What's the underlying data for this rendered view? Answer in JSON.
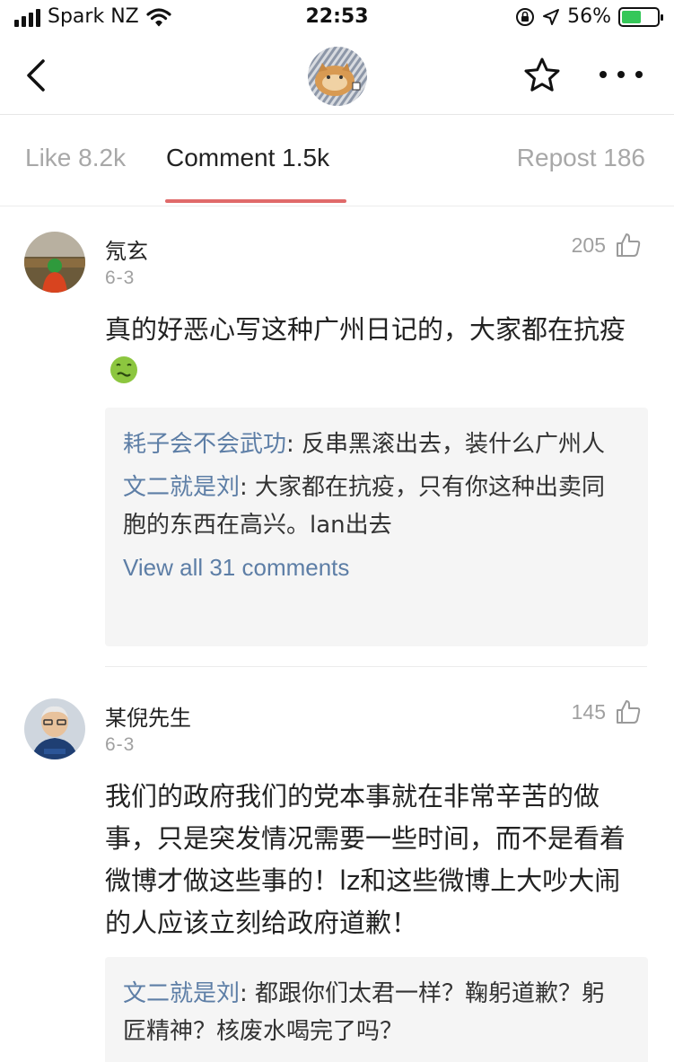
{
  "status_bar": {
    "carrier": "Spark NZ",
    "time": "22:53",
    "battery": "56%",
    "battery_level": 0.56,
    "icons": [
      "signal-icon",
      "wifi-icon",
      "orientation-lock-icon",
      "location-icon",
      "battery-charging-icon"
    ]
  },
  "nav": {
    "icons": [
      "back-chevron-icon",
      "star-icon",
      "more-dots-icon"
    ]
  },
  "tabs": [
    {
      "label": "Like 8.2k"
    },
    {
      "label": "Comment 1.5k"
    },
    {
      "label": "Repost 186"
    }
  ],
  "active_tab": "Comment 1.5k",
  "colors": {
    "accent": "#e06a6a",
    "link": "#5d7ea6",
    "reply_bg": "#f5f5f5"
  },
  "comments": [
    {
      "name": "氖玄",
      "date": "6-3",
      "likes": "205",
      "text": "真的好恶心写这种广州日记的，大家都在抗疫",
      "emoji": "nauseated-face-icon",
      "replies": [
        {
          "name": "耗子会不会武功",
          "sep": ": ",
          "text": "反串黑滚出去，装什么广州人"
        },
        {
          "name": "文二就是刘",
          "sep": ": ",
          "text": "大家都在抗疫，只有你这种出卖同胞的东西在高兴。lan出去"
        }
      ],
      "view_all": "View all 31 comments"
    },
    {
      "name": "某倪先生",
      "date": "6-3",
      "likes": "145",
      "text": "我们的政府我们的党本事就在非常辛苦的做事，只是突发情况需要一些时间，而不是看着微博才做这些事的！lz和这些微博上大吵大闹的人应该立刻给政府道歉！",
      "replies": [
        {
          "name": "文二就是刘",
          "sep": ": ",
          "text": "都跟你们太君一样？鞠躬道歉？躬匠精神？核废水喝完了吗？"
        }
      ]
    }
  ]
}
